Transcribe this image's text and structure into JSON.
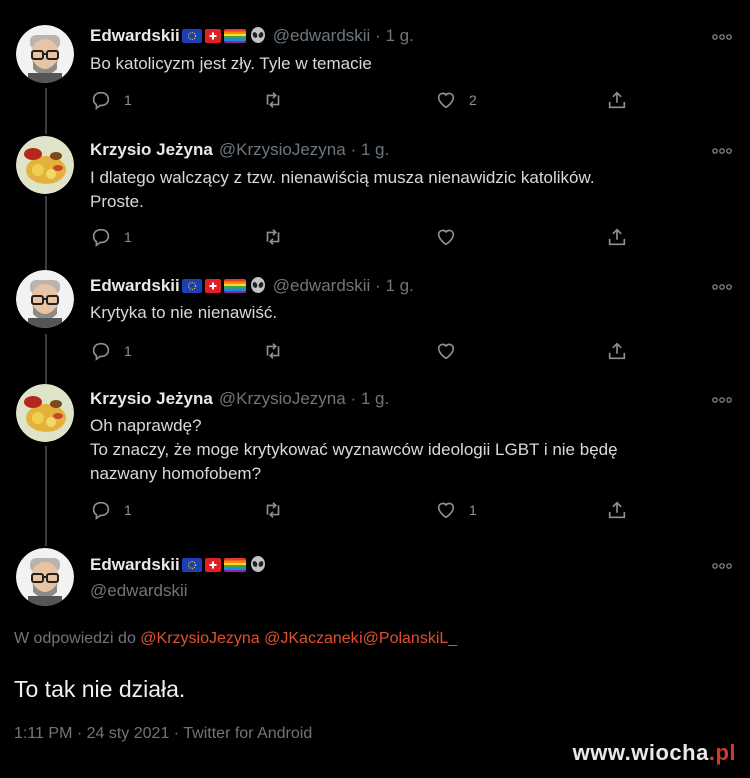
{
  "tweets": [
    {
      "name": "Edwardskii",
      "emoji_set": [
        "eu-flag",
        "swiss-flag",
        "rainbow-flag",
        "alien"
      ],
      "handle": "@edwardskii",
      "time": "1 g.",
      "text_lines": [
        "Bo katolicyzm jest zły. Tyle w temacie"
      ],
      "reply_count": "1",
      "retweet_count": "",
      "like_count": "2"
    },
    {
      "name": "Krzysio Jeżyna",
      "emoji_set": [],
      "handle": "@KrzysioJezyna",
      "time": "1 g.",
      "text_lines": [
        "I dlatego walczący z tzw. nienawiścią musza nienawidzic katolików.",
        "Proste."
      ],
      "reply_count": "1",
      "retweet_count": "",
      "like_count": ""
    },
    {
      "name": "Edwardskii",
      "emoji_set": [
        "eu-flag",
        "swiss-flag",
        "rainbow-flag",
        "alien"
      ],
      "handle": "@edwardskii",
      "time": "1 g.",
      "text_lines": [
        "Krytyka to nie nienawiść."
      ],
      "reply_count": "1",
      "retweet_count": "",
      "like_count": ""
    },
    {
      "name": "Krzysio Jeżyna",
      "emoji_set": [],
      "handle": "@KrzysioJezyna",
      "time": "1 g.",
      "text_lines": [
        "Oh naprawdę?",
        "To znaczy, że moge krytykować wyznawców ideologii LGBT i nie będę",
        "nazwany homofobem?"
      ],
      "reply_count": "1",
      "retweet_count": "",
      "like_count": "1"
    }
  ],
  "main_tweet": {
    "name": "Edwardskii",
    "handle": "@edwardskii",
    "emoji_set": [
      "eu-flag",
      "swiss-flag",
      "rainbow-flag",
      "alien"
    ],
    "reply_prefix": "W odpowiedzi do",
    "mentions": [
      "@KrzysioJezyna",
      "@JKaczanek",
      "i@PolanskiL_"
    ],
    "text": "To tak nie działa.",
    "meta": "1:11 PM · 24 sty 2021 · Twitter for Android"
  },
  "watermark": {
    "main": "www.wiocha",
    "suffix": ".pl"
  },
  "colors": {
    "background": "#000000",
    "mention": "#e0502f",
    "muted": "#6e767d"
  },
  "icons": {
    "reply": "reply-icon",
    "retweet": "retweet-icon",
    "like": "heart-icon",
    "share": "share-icon",
    "more": "more-icon"
  }
}
